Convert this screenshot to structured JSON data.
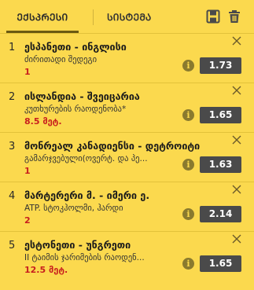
{
  "tabs": [
    {
      "label": "ᲔᲥᲡᲞᲠᲔᲡᲘ",
      "active": true
    },
    {
      "label": "ᲡᲘᲡᲢᲔᲛᲐ",
      "active": false
    }
  ],
  "icons": {
    "save": "save-icon",
    "trash": "trash-icon",
    "close": "close-icon",
    "info": "info-icon"
  },
  "info_glyph": "i",
  "colors": {
    "background": "#fbd94e",
    "odds_bg": "#4a4a4a",
    "pick": "#c81e1e",
    "tab_underline": "#6b5a11"
  },
  "bets": [
    {
      "num": "1",
      "title": "ესპანეთი - ინგლისი",
      "market": "ძირითადი შედეგი",
      "pick": "1",
      "odds": "1.73"
    },
    {
      "num": "2",
      "title": "ისლანდია - შვეიცარია",
      "market": "კუთხურების რაოდენობა*",
      "pick": "8.5 მეტ.",
      "odds": "1.65"
    },
    {
      "num": "3",
      "title": "მონრეალ კანადიენსი - დეტროიტი",
      "market": "გამარჯვებული(ოვერტ. და პე...",
      "pick": "1",
      "odds": "1.63"
    },
    {
      "num": "4",
      "title": "მარტერერი მ. - იმერი ე.",
      "market": "ATP. სტოკჰოლმი, ჰარდი",
      "pick": "2",
      "odds": "2.14"
    },
    {
      "num": "5",
      "title": "ესტონეთი - უნგრეთი",
      "market": "II ტაიმის ჯარიმების რაოდენ...",
      "pick": "12.5 მეტ.",
      "odds": "1.65"
    }
  ]
}
